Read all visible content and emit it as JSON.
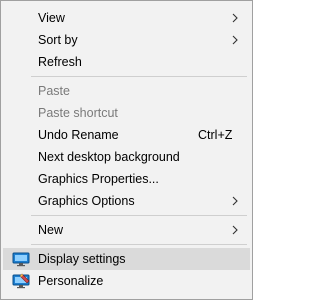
{
  "menu": {
    "view": "View",
    "sort_by": "Sort by",
    "refresh": "Refresh",
    "paste": "Paste",
    "paste_shortcut": "Paste shortcut",
    "undo_rename": "Undo Rename",
    "undo_rename_shortcut": "Ctrl+Z",
    "next_desktop_background": "Next desktop background",
    "graphics_properties": "Graphics Properties...",
    "graphics_options": "Graphics Options",
    "new": "New",
    "display_settings": "Display settings",
    "personalize": "Personalize"
  },
  "icons": {
    "submenu_arrow": "chevron-right-icon",
    "display_settings": "monitor-icon",
    "personalize": "personalize-icon"
  },
  "colors": {
    "menu_background": "#f2f2f2",
    "highlight": "#dadada",
    "disabled_text": "#7a7a7a",
    "separator": "#cfcfcf"
  }
}
